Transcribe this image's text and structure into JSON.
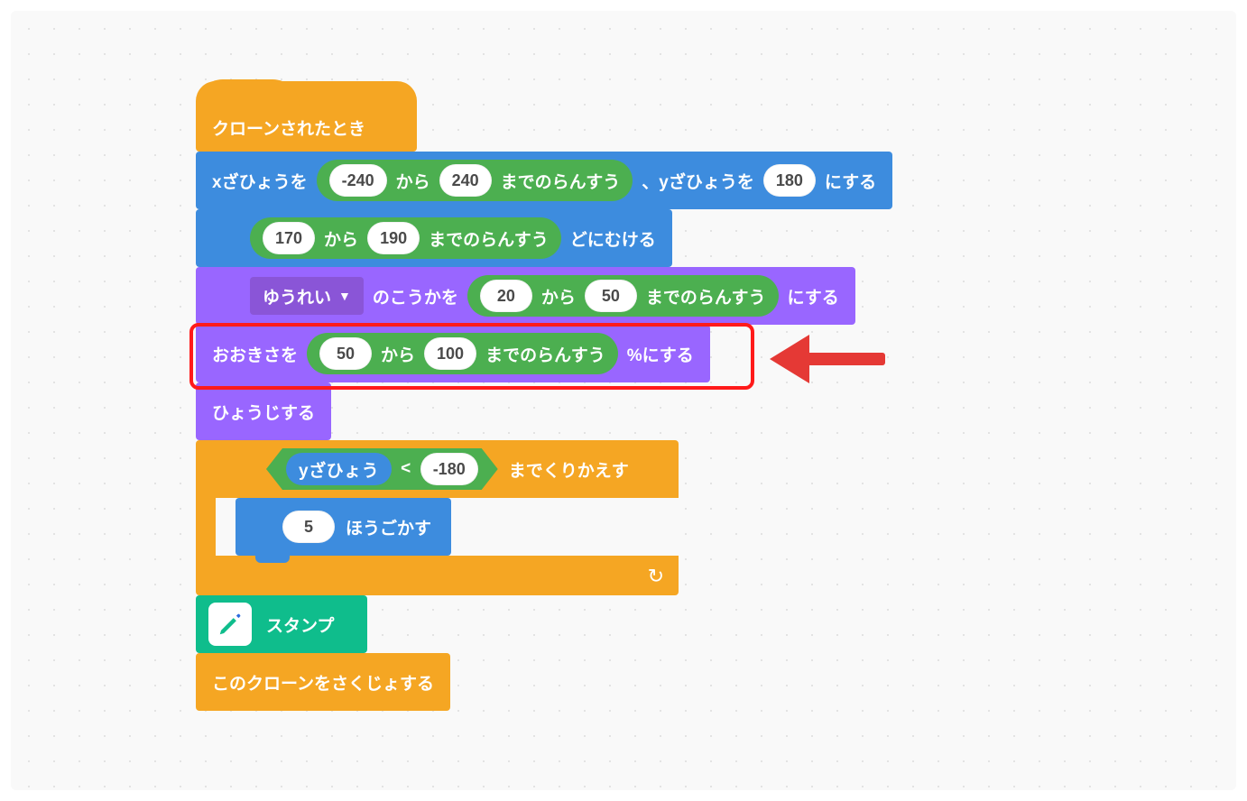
{
  "hat": {
    "label": "クローンされたとき"
  },
  "motion_goto": {
    "prefix": "xざひょうを",
    "rand": {
      "from": "-240",
      "to": "240",
      "label1": "から",
      "label2": "までのらんすう"
    },
    "mid": "、yざひょうを",
    "y": "180",
    "suffix": "にする"
  },
  "motion_point": {
    "rand": {
      "from": "170",
      "to": "190",
      "label1": "から",
      "label2": "までのらんすう"
    },
    "suffix": "どにむける"
  },
  "looks_effect": {
    "dropdown": "ゆうれい",
    "mid": "のこうかを",
    "rand": {
      "from": "20",
      "to": "50",
      "label1": "から",
      "label2": "までのらんすう"
    },
    "suffix": "にする"
  },
  "looks_size": {
    "prefix": "おおきさを",
    "rand": {
      "from": "50",
      "to": "100",
      "label1": "から",
      "label2": "までのらんすう"
    },
    "suffix": "%にする"
  },
  "looks_show": {
    "label": "ひょうじする"
  },
  "repeat_until": {
    "bool": {
      "var": "yざひょう",
      "op": "<",
      "val": "-180"
    },
    "suffix": "までくりかえす",
    "inner": {
      "steps": "5",
      "label": "ほうごかす"
    }
  },
  "pen_stamp": {
    "label": "スタンプ"
  },
  "delete_clone": {
    "label": "このクローンをさくじょする"
  },
  "colors": {
    "motion": "#3D8CDE",
    "looks": "#9966FF",
    "control": "#F5A623",
    "operator": "#4CAF50",
    "pen": "#0FBD8C",
    "highlight": "#ff1a1a"
  }
}
